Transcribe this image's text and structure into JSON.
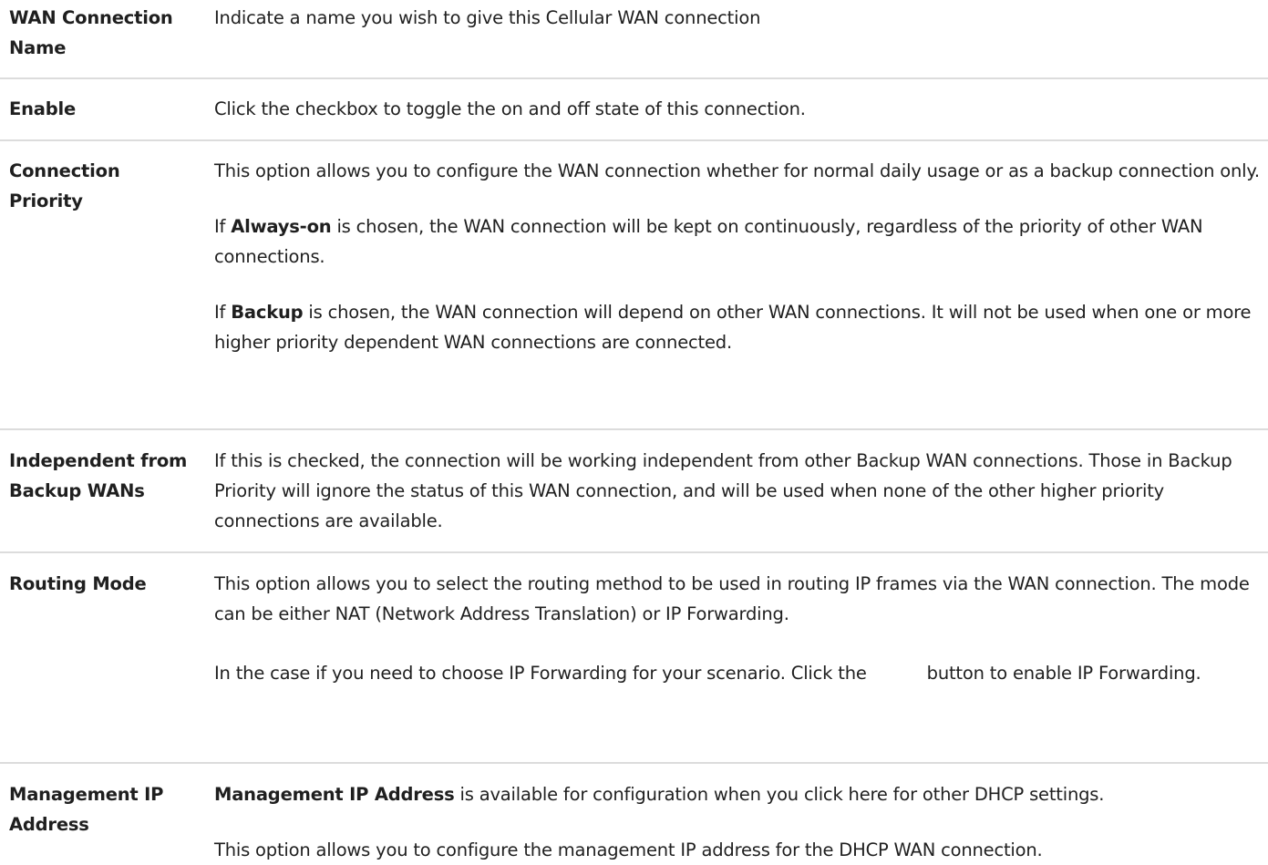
{
  "rows": [
    {
      "term": "WAN Connection Name",
      "desc": {
        "p1": "Indicate a name you wish to give this Cellular WAN connection"
      }
    },
    {
      "term": "Enable",
      "desc": {
        "p1": "Click the checkbox to toggle the on and off state of this connection."
      }
    },
    {
      "term": "Connection Priority",
      "desc": {
        "p1": "This option allows you to configure the WAN connection whether for normal daily usage or as a backup connection only.",
        "p2_pre": "If ",
        "p2_bold": "Always-on",
        "p2_post": " is chosen, the WAN connection will be kept on continuously, regardless of the priority of other WAN connections.",
        "p3_pre": "If ",
        "p3_bold": "Backup",
        "p3_post": " is chosen, the WAN connection will depend on other WAN connections. It will not be used when one or more higher priority dependent WAN connections are connected."
      }
    },
    {
      "term": "Independent from Backup WANs",
      "desc": {
        "p1": "If this is checked, the connection will be working independent from other Backup WAN connections. Those in Backup Priority will ignore the status of this WAN connection, and will be used when none of the other higher priority connections are available."
      }
    },
    {
      "term": "Routing Mode",
      "desc": {
        "p1": "This option allows you to select the routing method to be used in routing IP frames via the WAN connection. The mode can be either NAT (Network Address Translation) or IP Forwarding.",
        "p2_pre": "In the case if you need to choose IP Forwarding for your scenario. Click the ",
        "p2_post": " button to enable IP Forwarding."
      }
    },
    {
      "term": "Management IP Address",
      "desc": {
        "p1_bold": "Management IP Address",
        "p1_post": " is available for configuration when you click here for other DHCP settings.",
        "p2": "This option allows you to configure the management IP address for the DHCP WAN connection."
      }
    }
  ]
}
